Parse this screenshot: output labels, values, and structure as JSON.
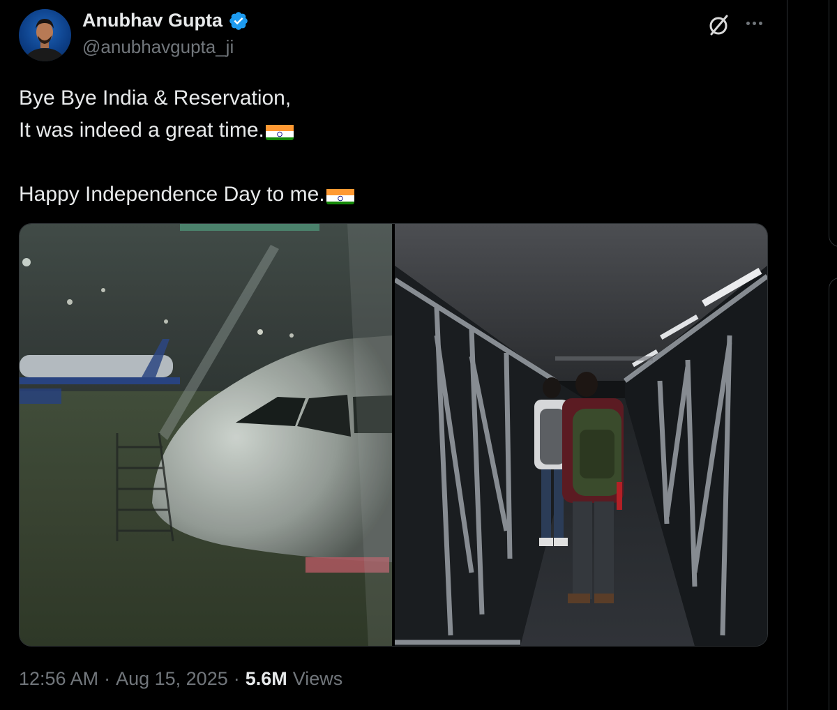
{
  "author": {
    "name": "Anubhav Gupta",
    "handle": "@anubhavgupta_ji",
    "verified": true
  },
  "tweet": {
    "lines": [
      "Bye Bye India & Reservation,",
      "It was indeed a great time.",
      "",
      "Happy Independence Day to me."
    ]
  },
  "media": [
    {
      "name": "photo-aircraft-at-gate",
      "description": ""
    },
    {
      "name": "photo-jet-bridge",
      "description": ""
    }
  ],
  "meta": {
    "time": "12:56 AM",
    "date": "Aug 15, 2025",
    "views_count": "5.6M",
    "views_label": "Views",
    "separator": "·"
  },
  "icons": {
    "verified": "verified-badge-icon",
    "grok": "grok-icon",
    "more": "more-options-icon",
    "flag": "india-flag-emoji"
  },
  "colors": {
    "background": "#000000",
    "text_primary": "#e7e9ea",
    "text_secondary": "#71767b",
    "verified_blue": "#1d9bf0",
    "border": "#2f3336"
  }
}
